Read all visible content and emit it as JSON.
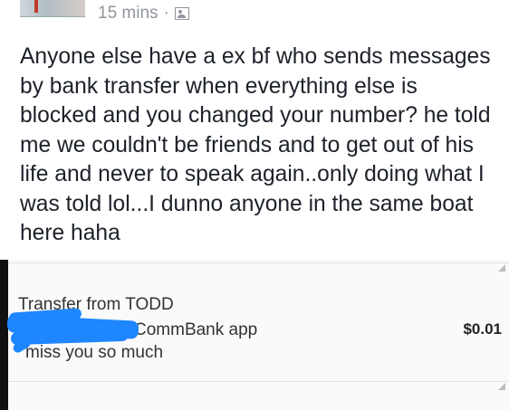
{
  "post": {
    "timestamp": "15 mins",
    "separator": "·",
    "audience_icon": "friends-audience-icon",
    "text": "Anyone else have a ex bf who sends messages by bank transfer when everything else is blocked and you changed your number? he told me we couldn't be friends and to get out of his life and never to speak again..only doing what I was told lol...I dunno anyone in the same boat here haha"
  },
  "transaction": {
    "title": "Transfer from TODD",
    "source": "CommBank app",
    "message": "miss you so much",
    "amount": "$0.01",
    "redaction_color": "#1e86ff"
  }
}
